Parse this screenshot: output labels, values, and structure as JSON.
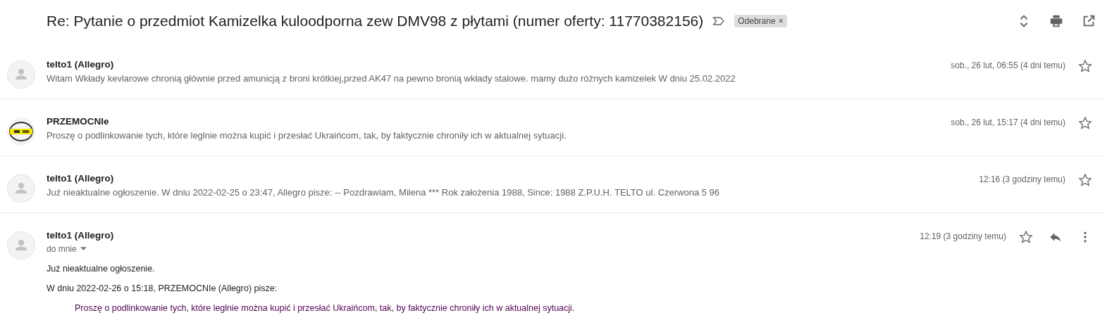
{
  "thread": {
    "subject": "Re: Pytanie o przedmiot Kamizelka kuloodporna zew DMV98 z płytami (numer oferty: 11770382156)",
    "label": {
      "text": "Odebrane",
      "remove": "×"
    }
  },
  "messages": [
    {
      "kind": "collapsed",
      "avatar": {
        "kind": "placeholder"
      },
      "sender": "telto1 (Allegro)",
      "snippet": "Witam Wkłady kevlarowe chronią głównie przed amunicją z broni krótkiej,przed AK47 na pewno bronią wkłady stalowe. mamy dużo różnych kamizelek W dniu 25.02.2022",
      "date": "sob., 26 lut, 06:55 (4 dni temu)",
      "starred": false
    },
    {
      "kind": "collapsed",
      "sender": "PRZEMOCNIe",
      "snippet": "Proszę o podlinkowanie tych, które leglnie można kupić i przesłać Ukraińcom, tak, by faktycznie chroniły ich w aktualnej sytuacji.",
      "date": "sob., 26 lut, 15:17 (4 dni temu)",
      "starred": false
    },
    {
      "kind": "collapsed",
      "avatar": {
        "kind": "placeholder"
      },
      "sender": "telto1 (Allegro)",
      "snippet": "Już nieaktualne ogłoszenie. W dniu 2022-02-25 o 23:47, Allegro pisze: -- Pozdrawiam, Milena *** Rok założenia 1988, Since: 1988 Z.P.U.H. TELTO ul. Czerwona 5 96",
      "date": "12:16 (3 godziny temu)",
      "starred": false
    },
    {
      "kind": "expanded",
      "avatar": {
        "kind": "placeholder"
      },
      "sender": "telto1 (Allegro)",
      "recipient": "do mnie",
      "date": "12:19 (3 godziny temu)",
      "starred": false,
      "body": [
        "Już nieaktualne ogłoszenie.",
        "W dniu 2022-02-26 o 15:18, PRZEMOCNIe (Allegro) pisze:"
      ],
      "quote": "Proszę o podlinkowanie tych, które leglnie można kupić i przesłać Ukraińcom, tak, by faktycznie chroniły ich w aktualnej sytuacji."
    }
  ]
}
